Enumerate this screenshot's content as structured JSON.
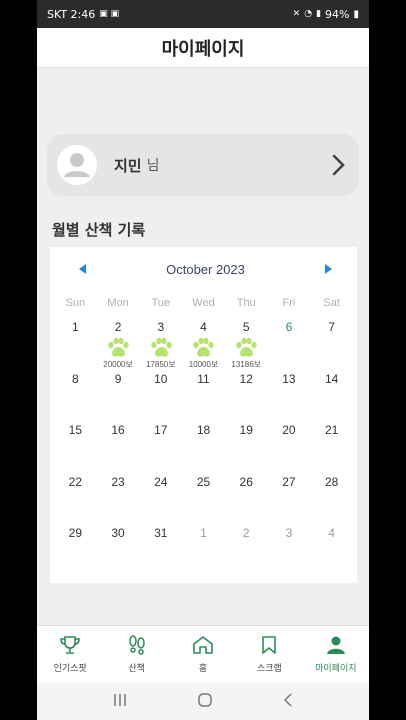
{
  "status_bar": {
    "carrier_time": "SKT 2:46",
    "battery": "94%"
  },
  "header": {
    "title": "마이페이지"
  },
  "profile": {
    "name": "지민",
    "suffix": "님"
  },
  "section": {
    "title": "월별 산책 기록"
  },
  "calendar": {
    "month_label": "October 2023",
    "weekdays": [
      "Sun",
      "Mon",
      "Tue",
      "Wed",
      "Thu",
      "Fri",
      "Sat"
    ],
    "days": [
      {
        "n": "1"
      },
      {
        "n": "2",
        "steps": "20000보"
      },
      {
        "n": "3",
        "steps": "17850보"
      },
      {
        "n": "4",
        "steps": "10000보"
      },
      {
        "n": "5",
        "steps": "13186보"
      },
      {
        "n": "6",
        "today": true
      },
      {
        "n": "7"
      },
      {
        "n": "8"
      },
      {
        "n": "9"
      },
      {
        "n": "10"
      },
      {
        "n": "11"
      },
      {
        "n": "12"
      },
      {
        "n": "13"
      },
      {
        "n": "14"
      },
      {
        "n": "15"
      },
      {
        "n": "16"
      },
      {
        "n": "17"
      },
      {
        "n": "18"
      },
      {
        "n": "19"
      },
      {
        "n": "20"
      },
      {
        "n": "21"
      },
      {
        "n": "22"
      },
      {
        "n": "23"
      },
      {
        "n": "24"
      },
      {
        "n": "25"
      },
      {
        "n": "26"
      },
      {
        "n": "27"
      },
      {
        "n": "28"
      },
      {
        "n": "29"
      },
      {
        "n": "30"
      },
      {
        "n": "31"
      },
      {
        "n": "1",
        "other": true
      },
      {
        "n": "2",
        "other": true
      },
      {
        "n": "3",
        "other": true
      },
      {
        "n": "4",
        "other": true
      }
    ]
  },
  "nav": {
    "items": [
      {
        "label": "인기스팟",
        "icon": "trophy-icon"
      },
      {
        "label": "산책",
        "icon": "footprints-icon"
      },
      {
        "label": "홈",
        "icon": "home-icon"
      },
      {
        "label": "스크랩",
        "icon": "bookmark-icon"
      },
      {
        "label": "마이페이지",
        "icon": "person-icon",
        "active": true
      }
    ]
  },
  "colors": {
    "accent": "#2e8b57",
    "paw": "#b5e36b",
    "nav_arrow": "#1e88e5"
  }
}
